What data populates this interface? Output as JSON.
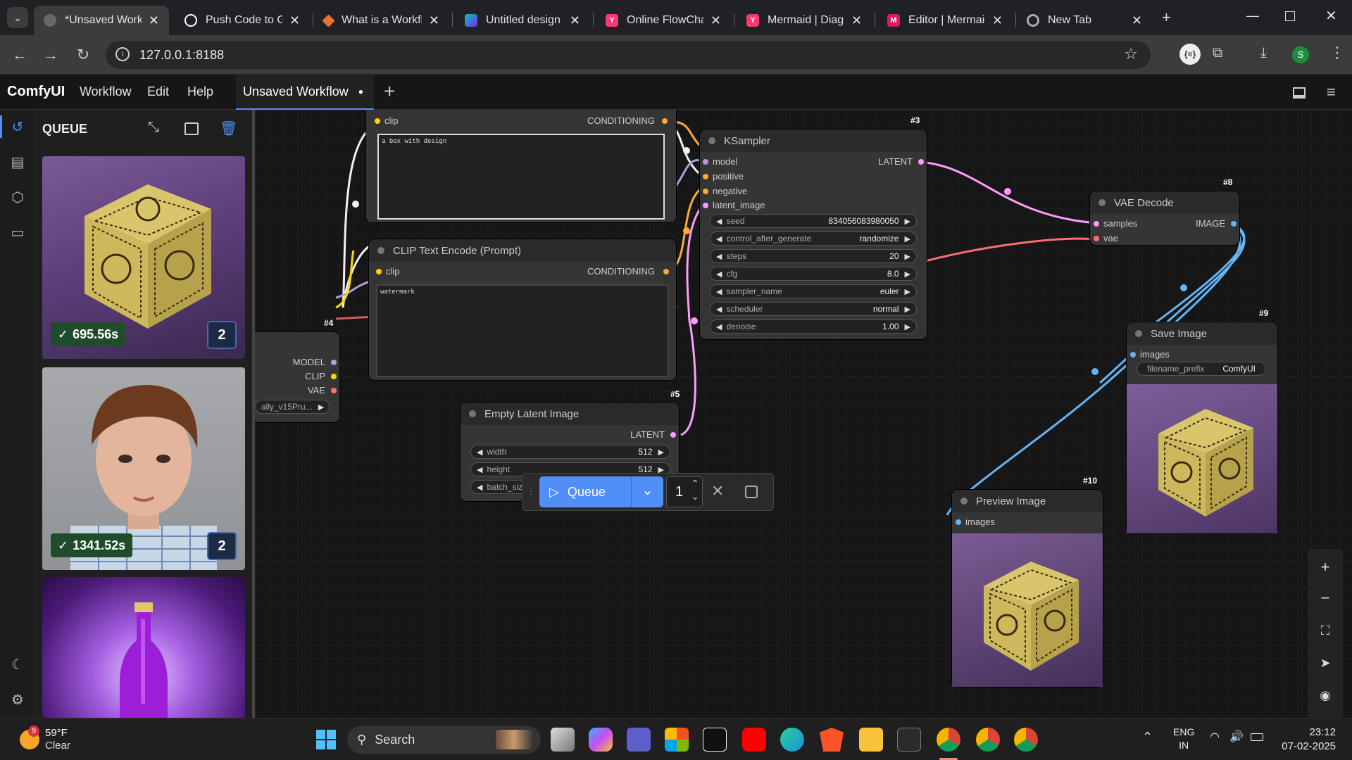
{
  "browser": {
    "tabs": [
      {
        "title": "*Unsaved Workfl",
        "active": true,
        "icon": "comfy-icon",
        "color": "#888888"
      },
      {
        "title": "Push Code to Git",
        "icon": "chatgpt-icon",
        "color": "#ffffff"
      },
      {
        "title": "What is a Workflo",
        "icon": "workflow-site-icon",
        "color": "#e8742b"
      },
      {
        "title": "Untitled design -",
        "icon": "canva-icon",
        "color": "#7d2ae8"
      },
      {
        "title": "Online FlowChar",
        "icon": "mermaid-icon",
        "color": "#ff3670"
      },
      {
        "title": "Mermaid | Diagra",
        "icon": "mermaid-icon",
        "color": "#ff3670"
      },
      {
        "title": "Editor | Mermaid",
        "icon": "mermaid-editor-icon",
        "color": "#e0195d"
      },
      {
        "title": "New Tab",
        "icon": "chrome-icon",
        "color": "#888888"
      }
    ],
    "url": "127.0.0.1:8188",
    "profile_initial": "S"
  },
  "menubar": {
    "brand": "ComfyUI",
    "items": [
      "Workflow",
      "Edit",
      "Help"
    ],
    "workflow_tab": "Unsaved Workflow",
    "workflow_tab_dot": "●",
    "add_tab": "+"
  },
  "queue_panel": {
    "title": "QUEUE",
    "items": [
      {
        "time": "695.56s",
        "count": "2",
        "image": "wooden-box-image"
      },
      {
        "time": "1341.52s",
        "count": "2",
        "image": "boy-portrait-image"
      },
      {
        "image": "purple-bottle-image"
      }
    ]
  },
  "nodes": {
    "clip_top": {
      "input": "clip",
      "output": "CONDITIONING",
      "text": "a box with design"
    },
    "clip_encode": {
      "title": "CLIP Text Encode (Prompt)",
      "input": "clip",
      "output": "CONDITIONING",
      "text": "watermark"
    },
    "checkpoint": {
      "id": "#4",
      "outputs": [
        "MODEL",
        "CLIP",
        "VAE"
      ],
      "ckpt_name": "ally_v15Pru..."
    },
    "ksampler": {
      "id": "#3",
      "title": "KSampler",
      "inputs": [
        "model",
        "positive",
        "negative",
        "latent_image"
      ],
      "output": "LATENT",
      "widgets": [
        {
          "name": "seed",
          "value": "834056083980050"
        },
        {
          "name": "control_after_generate",
          "value": "randomize"
        },
        {
          "name": "steps",
          "value": "20"
        },
        {
          "name": "cfg",
          "value": "8.0"
        },
        {
          "name": "sampler_name",
          "value": "euler"
        },
        {
          "name": "scheduler",
          "value": "normal"
        },
        {
          "name": "denoise",
          "value": "1.00"
        }
      ]
    },
    "empty_latent": {
      "id": "#5",
      "title": "Empty Latent Image",
      "output": "LATENT",
      "widgets": [
        {
          "name": "width",
          "value": "512"
        },
        {
          "name": "height",
          "value": "512"
        },
        {
          "name": "batch_siz",
          "value": ""
        }
      ]
    },
    "vae_decode": {
      "id": "#8",
      "title": "VAE Decode",
      "inputs": [
        "samples",
        "vae"
      ],
      "output": "IMAGE"
    },
    "save_image": {
      "id": "#9",
      "title": "Save Image",
      "input": "images",
      "widget_name": "filename_prefix",
      "widget_value": "ComfyUI"
    },
    "preview_image": {
      "id": "#10",
      "title": "Preview Image",
      "input": "images"
    }
  },
  "queue_bar": {
    "button": "Queue",
    "batch_count": "1"
  },
  "taskbar": {
    "weather_temp": "59°F",
    "weather_desc": "Clear",
    "weather_badge": "9",
    "search": "Search",
    "lang_top": "ENG",
    "lang_bottom": "IN",
    "time": "23:12",
    "date": "07-02-2025"
  },
  "colors": {
    "model": "#b39ddb",
    "clip": "#ffd500",
    "vae": "#ff6e6e",
    "conditioning": "#ffa931",
    "latent": "#ff9cf9",
    "image": "#64b5f6",
    "queue_button": "#4f8ff7"
  }
}
